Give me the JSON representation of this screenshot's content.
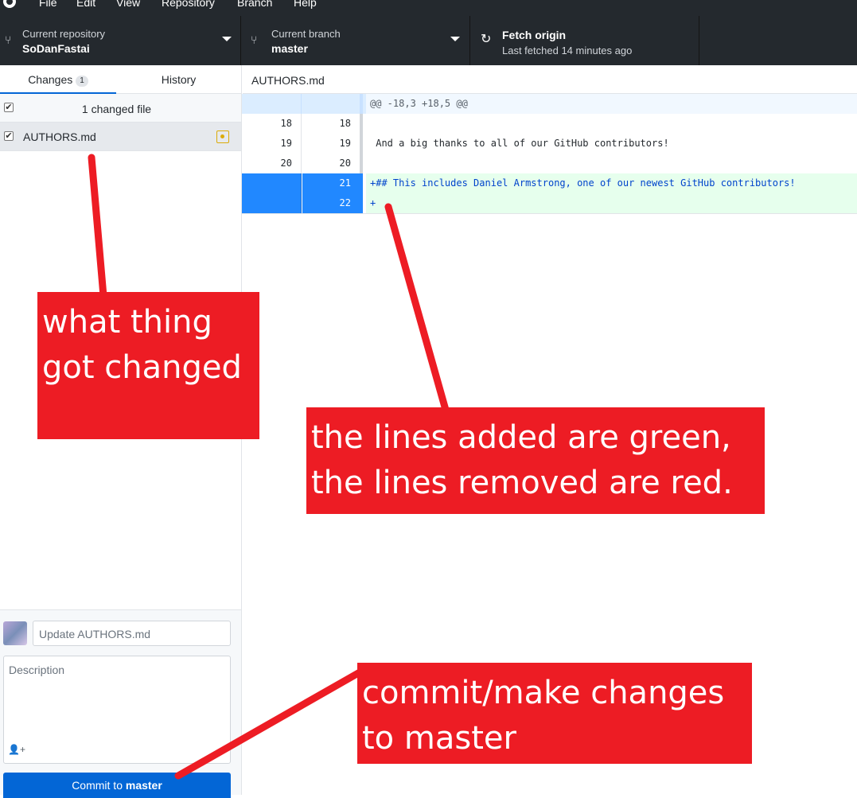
{
  "menu": {
    "items": [
      "File",
      "Edit",
      "View",
      "Repository",
      "Branch",
      "Help"
    ]
  },
  "toolbar": {
    "repo": {
      "label": "Current repository",
      "value": "SoDanFastai"
    },
    "branch": {
      "label": "Current branch",
      "value": "master"
    },
    "fetch": {
      "label": "Fetch origin",
      "status": "Last fetched 14 minutes ago"
    }
  },
  "sidebar": {
    "tabs": {
      "changes": "Changes",
      "changes_count": "1",
      "history": "History"
    },
    "changed_files_label": "1 changed file",
    "files": [
      {
        "name": "AUTHORS.md",
        "status": "modified"
      }
    ],
    "commit": {
      "summary_placeholder": "Update AUTHORS.md",
      "description_placeholder": "Description",
      "button_prefix": "Commit to ",
      "button_branch": "master"
    }
  },
  "diff": {
    "file": "AUTHORS.md",
    "hunk": "@@ -18,3 +18,5 @@",
    "lines": [
      {
        "old": "18",
        "new": "18",
        "text": "",
        "type": "context"
      },
      {
        "old": "19",
        "new": "19",
        "text": " And a big thanks to all of our GitHub contributors!",
        "type": "context"
      },
      {
        "old": "20",
        "new": "20",
        "text": "",
        "type": "context"
      },
      {
        "old": "",
        "new": "21",
        "text": "+## This includes Daniel Armstrong, one of our newest GitHub contributors!",
        "type": "added"
      },
      {
        "old": "",
        "new": "22",
        "text": "+",
        "type": "added"
      }
    ]
  },
  "annotations": {
    "what_changed": [
      "what thing",
      "got changed"
    ],
    "colors_note": [
      "the lines added are green,",
      "the lines removed are red."
    ],
    "commit_note": [
      "commit/make changes",
      "to master"
    ]
  },
  "colors": {
    "toolbar": "#24292e",
    "accent": "#0366d6",
    "added_bg": "#e6ffed",
    "annotation": "#ed1c24"
  }
}
